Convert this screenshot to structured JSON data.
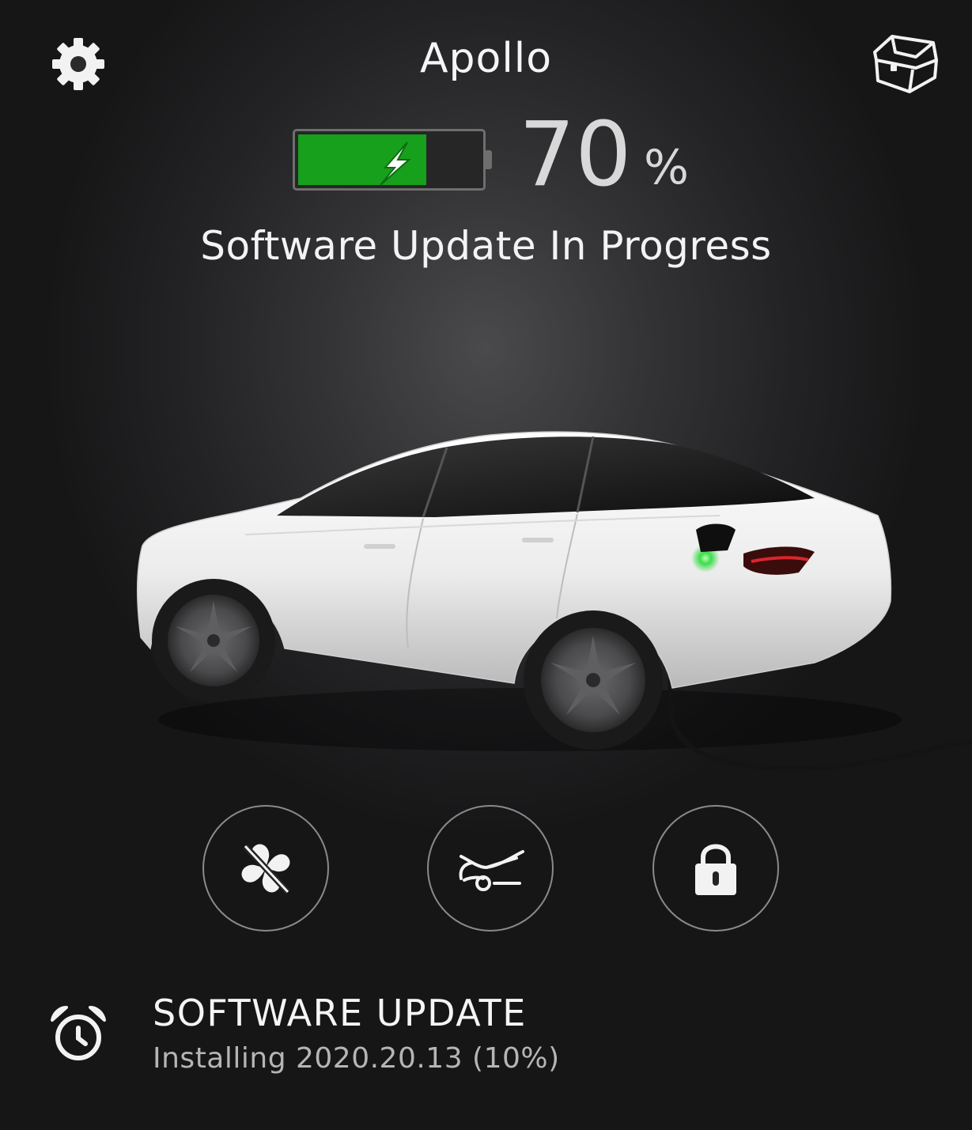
{
  "header": {
    "title": "Apollo",
    "settings_icon": "gear-icon",
    "frunk_icon": "frunk-chest-icon"
  },
  "battery": {
    "level_percent": 70,
    "value": "70",
    "unit": "%",
    "charging": true,
    "fill_color": "#17a01c"
  },
  "status": {
    "text": "Software Update In Progress"
  },
  "controls": [
    {
      "name": "climate",
      "icon": "fan-off-icon"
    },
    {
      "name": "trunk",
      "icon": "open-trunk-icon"
    },
    {
      "name": "lock",
      "icon": "lock-icon"
    }
  ],
  "software_update": {
    "icon": "alarm-clock-icon",
    "title": "SOFTWARE UPDATE",
    "detail": "Installing 2020.20.13 (10%)"
  },
  "colors": {
    "charge_port_light": "#3ddc4a",
    "background": "#222224"
  }
}
